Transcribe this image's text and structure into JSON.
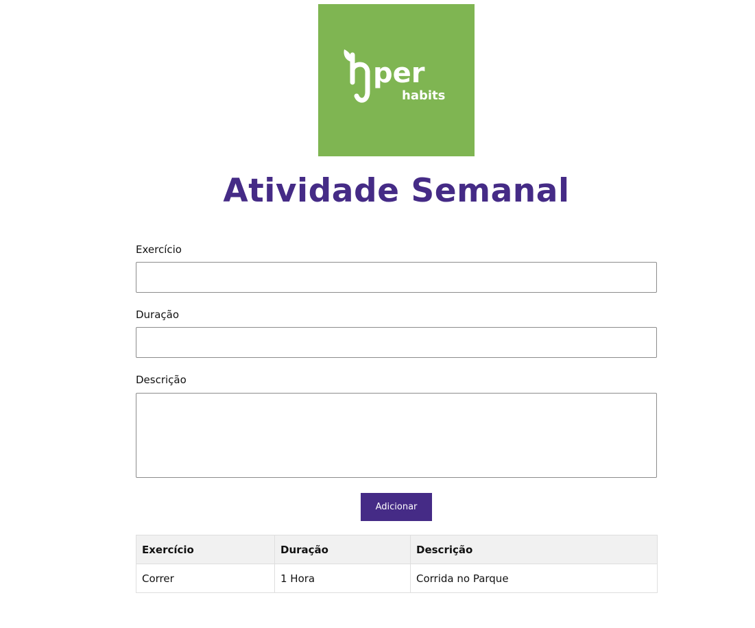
{
  "logo": {
    "word_main": "hper",
    "word_sub": "habits",
    "background_color": "#7fb552"
  },
  "page": {
    "title": "Atividade Semanal",
    "accent_color": "#452b86"
  },
  "form": {
    "exercise_label": "Exercício",
    "exercise_value": "",
    "duration_label": "Duração",
    "duration_value": "",
    "description_label": "Descrição",
    "description_value": "",
    "add_button_label": "Adicionar"
  },
  "table": {
    "headers": [
      "Exercício",
      "Duração",
      "Descrição"
    ],
    "rows": [
      [
        "Correr",
        "1 Hora",
        "Corrida no Parque"
      ]
    ]
  }
}
